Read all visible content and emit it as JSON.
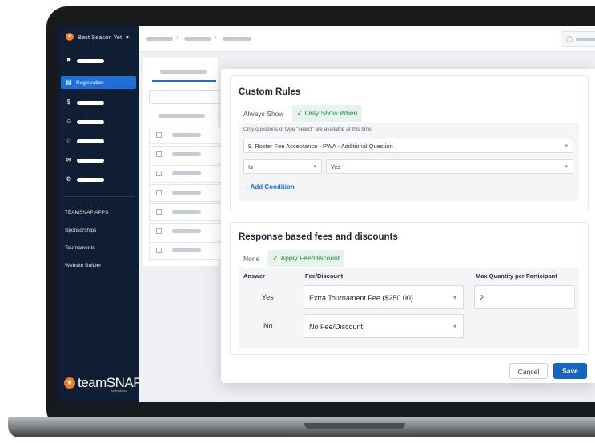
{
  "org": {
    "name": "Best Season Yet",
    "caret": "▾"
  },
  "sidebar": {
    "active_item": "Registration",
    "section_title": "TEAMSNAP APPS",
    "links": [
      "Sponsorships",
      "Tournaments",
      "Website Builder"
    ],
    "brand": {
      "name": "teamSNAP",
      "tagline": "for business"
    }
  },
  "custom_rules": {
    "title": "Custom Rules",
    "tabs": [
      "Always Show",
      "Only Show When"
    ],
    "selected_tab": "Only Show When",
    "hint": "Only questions of type \"select\" are available at this time.",
    "question": "9. Roster Fee Acceptance - PWA - Additional Question",
    "operator": "Is",
    "value": "Yes",
    "add_condition": "+ Add Condition"
  },
  "fees": {
    "title": "Response based fees and discounts",
    "tabs": [
      "None",
      "Apply Fee/Discount"
    ],
    "selected_tab": "Apply Fee/Discount",
    "columns": [
      "Answer",
      "Fee/Discount",
      "Max Quantity per Participant"
    ],
    "rows": [
      {
        "answer": "Yes",
        "fee": "Extra Tournament Fee ($250.00)",
        "max_qty": "2"
      },
      {
        "answer": "No",
        "fee": "No Fee/Discount",
        "max_qty": ""
      }
    ]
  },
  "actions": {
    "cancel": "Cancel",
    "save": "Save"
  },
  "colors": {
    "accent": "#1e6fd6",
    "success": "#1f8a4c",
    "brand_orange": "#f47b20",
    "sidebar_bg": "#0f1e33"
  }
}
